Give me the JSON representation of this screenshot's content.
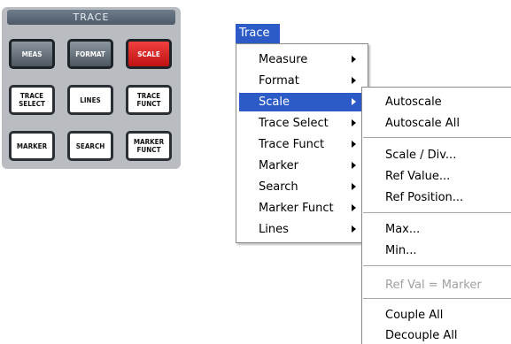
{
  "hardkey_panel": {
    "title": "TRACE",
    "buttons": [
      {
        "label": "MEAS",
        "style": "dark"
      },
      {
        "label": "FORMAT",
        "style": "dark"
      },
      {
        "label": "SCALE",
        "style": "red"
      },
      {
        "label": "TRACE\nSELECT",
        "style": "white"
      },
      {
        "label": "LINES",
        "style": "white"
      },
      {
        "label": "TRACE\nFUNCT",
        "style": "white"
      },
      {
        "label": "MARKER",
        "style": "white"
      },
      {
        "label": "SEARCH",
        "style": "white"
      },
      {
        "label": "MARKER\nFUNCT",
        "style": "white"
      }
    ]
  },
  "menubar": {
    "title": "Trace"
  },
  "trace_menu": {
    "items": [
      {
        "label": "Measure",
        "has_submenu": true,
        "active": false
      },
      {
        "label": "Format",
        "has_submenu": true,
        "active": false
      },
      {
        "label": "Scale",
        "has_submenu": true,
        "active": true
      },
      {
        "label": "Trace Select",
        "has_submenu": true,
        "active": false
      },
      {
        "label": "Trace Funct",
        "has_submenu": true,
        "active": false
      },
      {
        "label": "Marker",
        "has_submenu": true,
        "active": false
      },
      {
        "label": "Search",
        "has_submenu": true,
        "active": false
      },
      {
        "label": "Marker Funct",
        "has_submenu": true,
        "active": false
      },
      {
        "label": "Lines",
        "has_submenu": true,
        "active": false
      }
    ]
  },
  "scale_submenu": {
    "items": [
      {
        "label": "Autoscale",
        "enabled": true
      },
      {
        "label": "Autoscale All",
        "enabled": true
      },
      {
        "label": "Scale / Div...",
        "enabled": true
      },
      {
        "label": "Ref Value...",
        "enabled": true
      },
      {
        "label": "Ref Position...",
        "enabled": true
      },
      {
        "label": "Max...",
        "enabled": true
      },
      {
        "label": "Min...",
        "enabled": true
      },
      {
        "label": "Ref Val = Marker",
        "enabled": false
      },
      {
        "label": "Couple All",
        "enabled": true
      },
      {
        "label": "Decouple All",
        "enabled": true
      }
    ]
  },
  "colors": {
    "menu_highlight": "#2c5bc8",
    "scale_key": "#d81c1c",
    "panel_bg": "#b9bdc1",
    "disabled_text": "#a0a0a0"
  }
}
